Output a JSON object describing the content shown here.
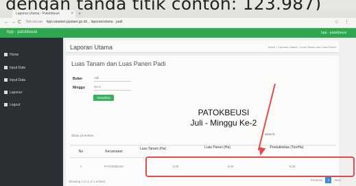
{
  "caption": "dengan tanda titik contoh: 123.987)",
  "browser": {
    "tab_title": "Laporan Utama - Patokbeusi",
    "tab_close": "×",
    "new_tab": "+",
    "back": "←",
    "forward": "→",
    "reload": "C",
    "secure_label": "Not secure",
    "url": "hpp.ranatam.ppstaet.go.id/... laporan/utama · padi",
    "star": "☆",
    "menu": "⋮"
  },
  "topbar": {
    "app_title": "hpp - patokbeusi",
    "user": "hpp - patokbeusi"
  },
  "sidebar": {
    "items": [
      {
        "label": "Home"
      },
      {
        "label": "Input Data"
      },
      {
        "label": "Input Data"
      },
      {
        "label": "Laporan"
      },
      {
        "label": "Logout"
      }
    ]
  },
  "header": {
    "page_title": "Laporan Utama",
    "breadcrumb": "Home > Laporan Utama > Luas Tanam dan Luas Panen"
  },
  "panel": {
    "title": "Luas Tanam dan Luas Panen Padi",
    "bulan_label": "Bulan",
    "bulan_value": "Juli",
    "minggu_label": "Minggu",
    "minggu_value": "Ke-2",
    "show_button": "Tampilkan"
  },
  "report": {
    "title_line1": "PATOKBEUSI",
    "title_line2": "Juli - Minggu Ke-2"
  },
  "table": {
    "show_entries": "Show 10 entries",
    "search_label": "Search:",
    "headers": {
      "no": "No",
      "kecamatan": "Kecamatan",
      "luas_tanam": "Luas Tanam (Ha)",
      "luas_panen": "Luas Panen (Ha)",
      "produktivitas": "Produktivitas (Ton/Ha)"
    },
    "rows": [
      {
        "no": "1",
        "kecamatan": "PATOKBEUSI",
        "luas_tanam": "0,00",
        "luas_panen": "0,00",
        "produktivitas": "0,00"
      }
    ],
    "showing": "Showing 1 to 1 of 1 entries",
    "pager_prev": "Previous",
    "pager_current": "1",
    "pager_next": "Next"
  },
  "colors": {
    "accent_green": "#2ea84f",
    "sidebar_dark": "#2b3035",
    "highlight_red": "#e8474b",
    "pager_blue": "#3a8ed8"
  }
}
